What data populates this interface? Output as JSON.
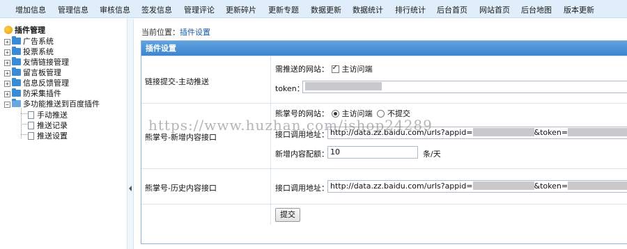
{
  "topnav": [
    "增加信息",
    "管理信息",
    "审核信息",
    "签发信息",
    "管理评论",
    "更新碎片",
    "更新专题",
    "数据更新",
    "数据统计",
    "排行统计",
    "后台首页",
    "网站首页",
    "后台地图",
    "版本更新"
  ],
  "sidebar": {
    "title": "插件管理",
    "items": [
      "广告系统",
      "投票系统",
      "友情链接管理",
      "留言板管理",
      "信息反馈管理",
      "防采集插件",
      "多功能推送到百度插件"
    ],
    "subitems": [
      "手动推送",
      "推送记录",
      "推送设置"
    ]
  },
  "breadcrumb": {
    "prefix": "当前位置：",
    "current": "插件设置"
  },
  "panel": {
    "title": "插件设置",
    "row1": {
      "label": "链接提交-主动推送",
      "site_label": "需推送的网站：",
      "site_option": "主访问端",
      "token_label": "token："
    },
    "row2": {
      "label": "熊掌号-新增内容接口",
      "site_label": "熊掌号的网站：",
      "opt1": "主访问端",
      "opt2": "不提交",
      "api_label": "接口调用地址：",
      "api_value": "http://data.zz.baidu.com/urls?appid=",
      "api_token": "&token=",
      "api_tail": "&t",
      "quota_label": "新增内容配额：",
      "quota_value": "10",
      "quota_unit": "条/天"
    },
    "row3": {
      "label": "熊掌号-历史内容接口",
      "api_label": "接口调用地址：",
      "api_value": "http://data.zz.baidu.com/urls?appid=",
      "api_token": "&token=",
      "api_tail": "&t"
    },
    "submit_label": "提交"
  },
  "watermark": "https://www.huzhan.com/ishop24289"
}
